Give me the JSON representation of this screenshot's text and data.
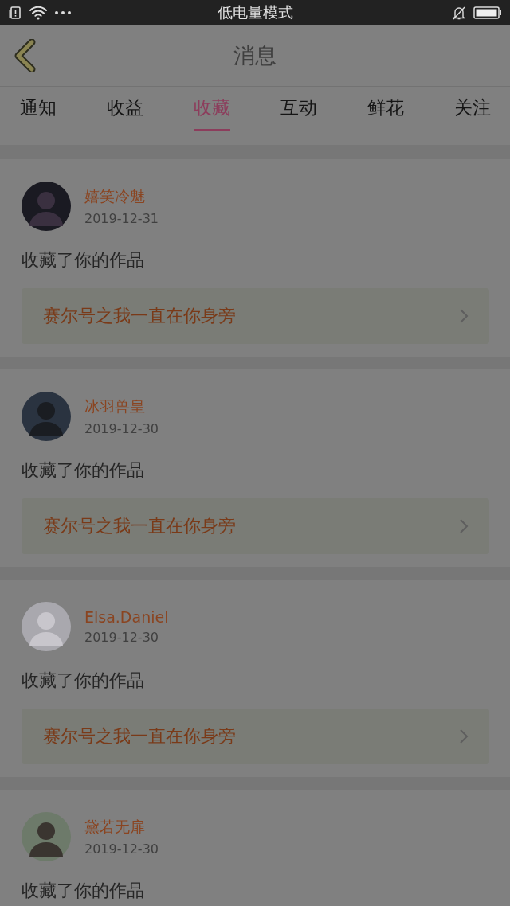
{
  "status_bar": {
    "title": "低电量模式"
  },
  "header": {
    "title": "消息"
  },
  "tabs": [
    {
      "label": "通知",
      "selected": false
    },
    {
      "label": "收益",
      "selected": false
    },
    {
      "label": "收藏",
      "selected": true
    },
    {
      "label": "互动",
      "selected": false
    },
    {
      "label": "鲜花",
      "selected": false
    },
    {
      "label": "关注",
      "selected": false
    }
  ],
  "messages": [
    {
      "user": "嬉笑冷魅",
      "date": "2019-12-31",
      "action": "收藏了你的作品",
      "work": "赛尔号之我一直在你身旁"
    },
    {
      "user": "冰羽兽皇",
      "date": "2019-12-30",
      "action": "收藏了你的作品",
      "work": "赛尔号之我一直在你身旁"
    },
    {
      "user": "Elsa.Daniel",
      "date": "2019-12-30",
      "action": "收藏了你的作品",
      "work": "赛尔号之我一直在你身旁"
    },
    {
      "user": "黛若无扉",
      "date": "2019-12-30",
      "action": "收藏了你的作品"
    }
  ]
}
